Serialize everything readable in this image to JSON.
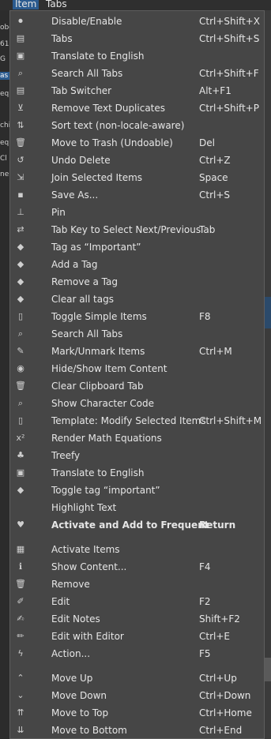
{
  "menubar": {
    "item_label": "Item",
    "tabs_label": "Tabs"
  },
  "menu": {
    "groups": [
      [
        {
          "label": "Disable/Enable",
          "shortcut": "Ctrl+Shift+X",
          "icon": "toggle-icon"
        },
        {
          "label": "Tabs",
          "shortcut": "Ctrl+Shift+S",
          "icon": "list-icon"
        },
        {
          "label": "Translate to English",
          "shortcut": "",
          "icon": "translate-icon"
        },
        {
          "label": "Search All Tabs",
          "shortcut": "Ctrl+Shift+F",
          "icon": "search-icon"
        },
        {
          "label": "Tab Switcher",
          "shortcut": "Alt+F1",
          "icon": "list-icon"
        },
        {
          "label": "Remove Text Duplicates",
          "shortcut": "Ctrl+Shift+P",
          "icon": "filter-off-icon"
        },
        {
          "label": "Sort text (non-locale-aware)",
          "shortcut": "",
          "icon": "sort-icon"
        },
        {
          "label": "Move to Trash (Undoable)",
          "shortcut": "Del",
          "icon": "trash-icon"
        },
        {
          "label": "Undo Delete",
          "shortcut": "Ctrl+Z",
          "icon": "undo-icon"
        },
        {
          "label": "Join Selected Items",
          "shortcut": "Space",
          "icon": "compress-icon"
        },
        {
          "label": "Save As...",
          "shortcut": "Ctrl+S",
          "icon": "save-icon"
        },
        {
          "label": "Pin",
          "shortcut": "",
          "icon": "pin-icon"
        },
        {
          "label": "Tab Key to Select Next/Previous",
          "shortcut": "Tab",
          "icon": "arrows-icon"
        },
        {
          "label": "Tag as “Important”",
          "shortcut": "",
          "icon": "tag-icon"
        },
        {
          "label": "Add a Tag",
          "shortcut": "",
          "icon": "tag-icon"
        },
        {
          "label": "Remove a Tag",
          "shortcut": "",
          "icon": "tag-icon"
        },
        {
          "label": "Clear all tags",
          "shortcut": "",
          "icon": "tag-icon"
        },
        {
          "label": "Toggle Simple Items",
          "shortcut": "F8",
          "icon": "file-icon"
        },
        {
          "label": "Search All Tabs",
          "shortcut": "",
          "icon": "search-icon"
        },
        {
          "label": "Mark/Unmark Items",
          "shortcut": "Ctrl+M",
          "icon": "brush-icon"
        },
        {
          "label": "Hide/Show Item Content",
          "shortcut": "",
          "icon": "eye-slash-icon"
        },
        {
          "label": "Clear Clipboard Tab",
          "shortcut": "",
          "icon": "trash-icon"
        },
        {
          "label": "Show Character Code",
          "shortcut": "",
          "icon": "search-icon"
        },
        {
          "label": "Template: Modify Selected Items",
          "shortcut": "Ctrl+Shift+M",
          "icon": "file-icon"
        },
        {
          "label": "Render Math Equations",
          "shortcut": "",
          "icon": "superscript-icon"
        },
        {
          "label": "Treefy",
          "shortcut": "",
          "icon": "tree-icon"
        },
        {
          "label": "Translate to English",
          "shortcut": "",
          "icon": "translate-icon"
        },
        {
          "label": "Toggle tag “important”",
          "shortcut": "",
          "icon": "tag-icon"
        },
        {
          "label": "Highlight Text",
          "shortcut": "",
          "icon": ""
        },
        {
          "label": "Activate and Add to Frequent",
          "shortcut": "Return",
          "icon": "heart-icon",
          "bold": true
        }
      ],
      [
        {
          "label": "Activate Items",
          "shortcut": "",
          "icon": "paste-icon"
        },
        {
          "label": "Show Content...",
          "shortcut": "F4",
          "icon": "info-icon"
        },
        {
          "label": "Remove",
          "shortcut": "",
          "icon": "trash-icon"
        },
        {
          "label": "Edit",
          "shortcut": "F2",
          "icon": "edit-icon"
        },
        {
          "label": "Edit Notes",
          "shortcut": "Shift+F2",
          "icon": "note-edit-icon"
        },
        {
          "label": "Edit with Editor",
          "shortcut": "Ctrl+E",
          "icon": "pencil-icon"
        },
        {
          "label": "Action...",
          "shortcut": "F5",
          "icon": "bolt-icon"
        }
      ],
      [
        {
          "label": "Move Up",
          "shortcut": "Ctrl+Up",
          "icon": "chevron-up-icon"
        },
        {
          "label": "Move Down",
          "shortcut": "Ctrl+Down",
          "icon": "chevron-down-icon"
        },
        {
          "label": "Move to Top",
          "shortcut": "Ctrl+Home",
          "icon": "double-chevron-up-icon"
        },
        {
          "label": "Move to Bottom",
          "shortcut": "Ctrl+End",
          "icon": "double-chevron-down-icon"
        }
      ]
    ]
  },
  "background": {
    "left_fragments": [
      "obo",
      "61",
      "G",
      "as",
      "eq",
      "chi",
      "eq",
      "Cl",
      "ne"
    ]
  },
  "colors": {
    "menu_bg": "#464646",
    "menu_border": "#5e5e5e",
    "text": "#e6e6e6",
    "accent": "#2b5b8f",
    "separator": "#5a5a5a"
  }
}
